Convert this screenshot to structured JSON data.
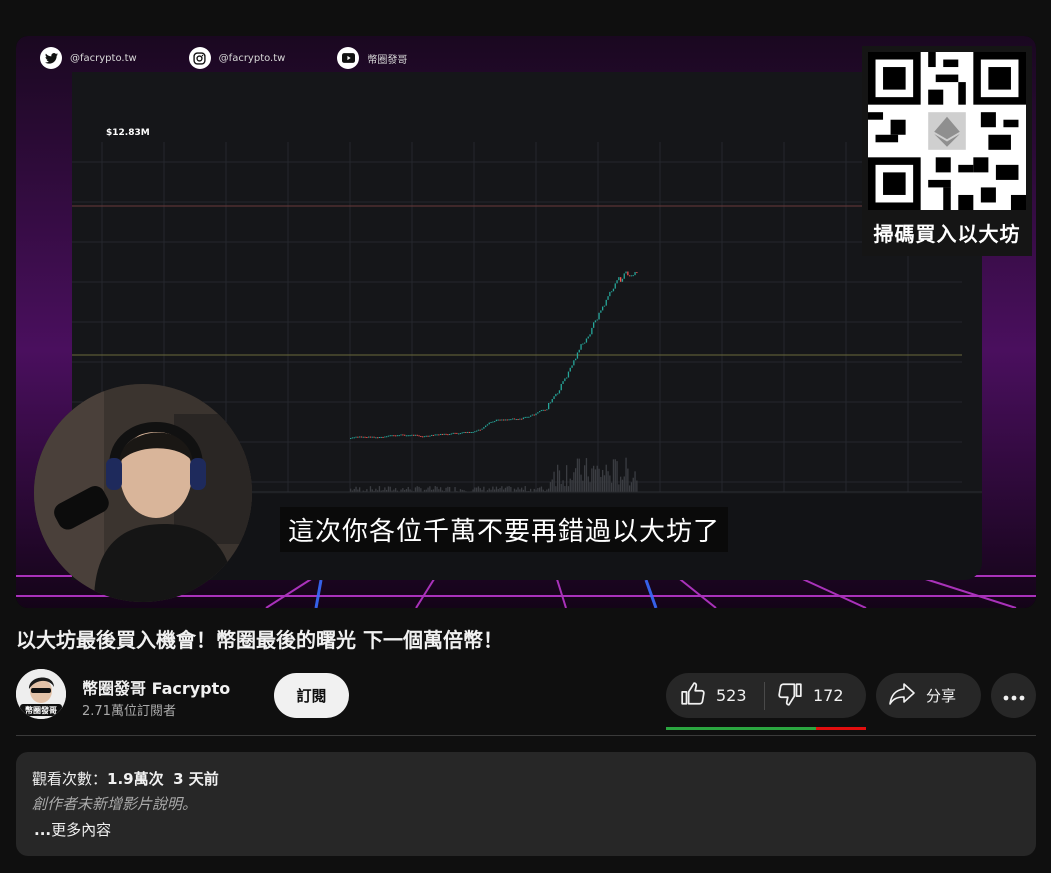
{
  "player": {
    "social": [
      {
        "icon": "twitter-icon",
        "handle": "@facrypto.tw"
      },
      {
        "icon": "instagram-icon",
        "handle": "@facrypto.tw"
      },
      {
        "icon": "youtube-icon",
        "handle": "幣圈發哥"
      }
    ],
    "qr_caption": "掃碼買入以大坊",
    "subtitle": "這次你各位千萬不要再錯過以大坊了",
    "chart_header_price": "$12.83M"
  },
  "video": {
    "title": "以大坊最後買入機會！幣圈最後的曙光 下一個萬倍幣！"
  },
  "channel": {
    "name": "幣圈發哥 Facrypto",
    "subscribers": "2.71萬位訂閱者",
    "subscribe_label": "訂閱",
    "avatar_text": "幣圈發哥"
  },
  "actions": {
    "likes": "523",
    "dislikes": "172",
    "like_ratio": 0.75,
    "share_label": "分享"
  },
  "description": {
    "views_label": "觀看次數：",
    "views": "1.9萬次",
    "date": "3 天前",
    "text": "創作者未新增影片說明。",
    "more_prefix": "...",
    "more_label": "更多內容"
  },
  "colors": {
    "like_bar": "#2ba640",
    "dislike_bar": "#e10e0e",
    "candle_up": "#26a69a",
    "candle_down": "#ef5350"
  }
}
